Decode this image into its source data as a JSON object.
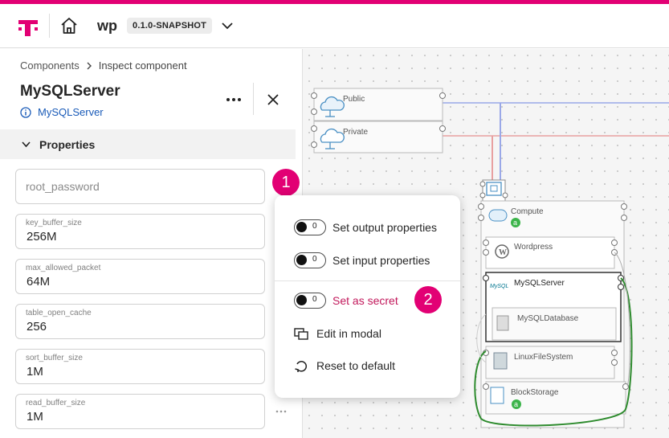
{
  "header": {
    "project": "wp",
    "version": "0.1.0-SNAPSHOT"
  },
  "breadcrumb": {
    "parent": "Components",
    "current": "Inspect component"
  },
  "component": {
    "title": "MySQLServer",
    "type": "MySQLServer"
  },
  "section": {
    "label": "Properties"
  },
  "fields": [
    {
      "label": "",
      "value": "",
      "placeholder": "root_password"
    },
    {
      "label": "key_buffer_size",
      "value": "256M"
    },
    {
      "label": "max_allowed_packet",
      "value": "64M"
    },
    {
      "label": "table_open_cache",
      "value": "256"
    },
    {
      "label": "sort_buffer_size",
      "value": "1M"
    },
    {
      "label": "read_buffer_size",
      "value": "1M"
    }
  ],
  "badges": [
    "1",
    "2"
  ],
  "menu": {
    "output_toggle": "0",
    "output_label": "Set output properties",
    "input_toggle": "0",
    "input_label": "Set input properties",
    "secret_toggle": "0",
    "secret_label": "Set as secret",
    "modal_label": "Edit in modal",
    "reset_label": "Reset to default"
  },
  "diagram": {
    "public": "Public",
    "private": "Private",
    "compute": "Compute",
    "wordpress": "Wordpress",
    "mysqlserver": "MySQLServer",
    "mysqldatabase": "MySQLDatabase",
    "linuxfilesystem": "LinuxFileSystem",
    "blockstorage": "BlockStorage",
    "mysql_logo": "MySQL"
  },
  "colors": {
    "accent": "#e20074",
    "link": "#1a5bb8",
    "network_public": "#9aa8e8",
    "network_private": "#e8a0a0",
    "relation_green": "#2e8b2e",
    "state_badge": "#3cb44a"
  }
}
